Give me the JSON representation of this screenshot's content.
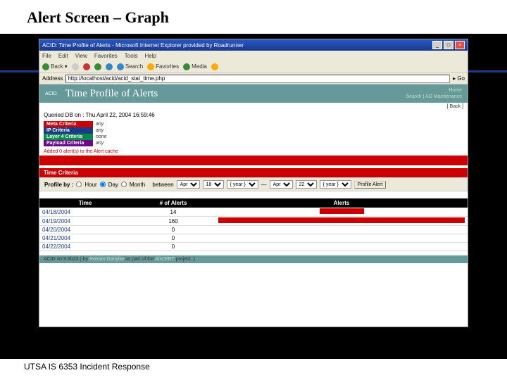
{
  "slide": {
    "title": "Alert Screen – Graph",
    "footer": "UTSA IS 6353 Incident Response"
  },
  "browser": {
    "title": "ACID: Time Profile of Alerts - Microsoft Internet Explorer provided by Roadrunner",
    "menu": [
      "File",
      "Edit",
      "View",
      "Favorites",
      "Tools",
      "Help"
    ],
    "toolbar": {
      "back": "Back",
      "search": "Search",
      "favorites": "Favorites",
      "media": "Media"
    },
    "address_label": "Address",
    "address": "http://localhost/acid/acid_stat_time.php",
    "go": "Go"
  },
  "acid": {
    "label": "ACID",
    "title": "Time Profile of Alerts",
    "links": {
      "home": "Home",
      "search": "Search",
      "ag": "AG Maintenance"
    },
    "back": "[ Back ]",
    "queried": "Queried DB on : Thu April 22, 2004 16:59:46",
    "criteria": [
      {
        "label": "Meta Criteria",
        "value": "any",
        "cls": "crit-meta"
      },
      {
        "label": "IP Criteria",
        "value": "any",
        "cls": "crit-ip"
      },
      {
        "label": "Layer 4 Criteria",
        "value": "none",
        "cls": "crit-l4"
      },
      {
        "label": "Payload Criteria",
        "value": "any",
        "cls": "crit-pay"
      }
    ],
    "added": "Added 0 alert(s) to the Alert cache",
    "time_criteria": "Time Criteria",
    "profile": {
      "by": "Profile by :",
      "hour": "Hour",
      "day": "Day",
      "month": "Month",
      "between": "between",
      "month1": "Apr",
      "day1": "18",
      "year1": "{ year }",
      "month2": "Apr",
      "day2": "22",
      "year2": "{ year }",
      "button": "Profile Alert"
    },
    "table": {
      "headers": [
        "Time",
        "# of Alerts",
        "Alerts"
      ],
      "rows": [
        {
          "time": "04/18/2004",
          "count": "14",
          "bar": 18
        },
        {
          "time": "04/19/2004",
          "count": "160",
          "bar": 100
        },
        {
          "time": "04/20/2004",
          "count": "0",
          "bar": 0
        },
        {
          "time": "04/21/2004",
          "count": "0",
          "bar": 0
        },
        {
          "time": "04/22/2004",
          "count": "0",
          "bar": 0
        }
      ]
    },
    "footer": {
      "version": "ACID v0.9.6b23 ( by ",
      "author": "Roman Danyliw",
      "mid": " as part of the ",
      "project": "AirCERT",
      "end": " project. )"
    }
  },
  "chart_data": {
    "type": "bar",
    "title": "Time Profile of Alerts",
    "xlabel": "Time",
    "ylabel": "# of Alerts",
    "categories": [
      "04/18/2004",
      "04/19/2004",
      "04/20/2004",
      "04/21/2004",
      "04/22/2004"
    ],
    "values": [
      14,
      160,
      0,
      0,
      0
    ],
    "ylim": [
      0,
      160
    ]
  }
}
